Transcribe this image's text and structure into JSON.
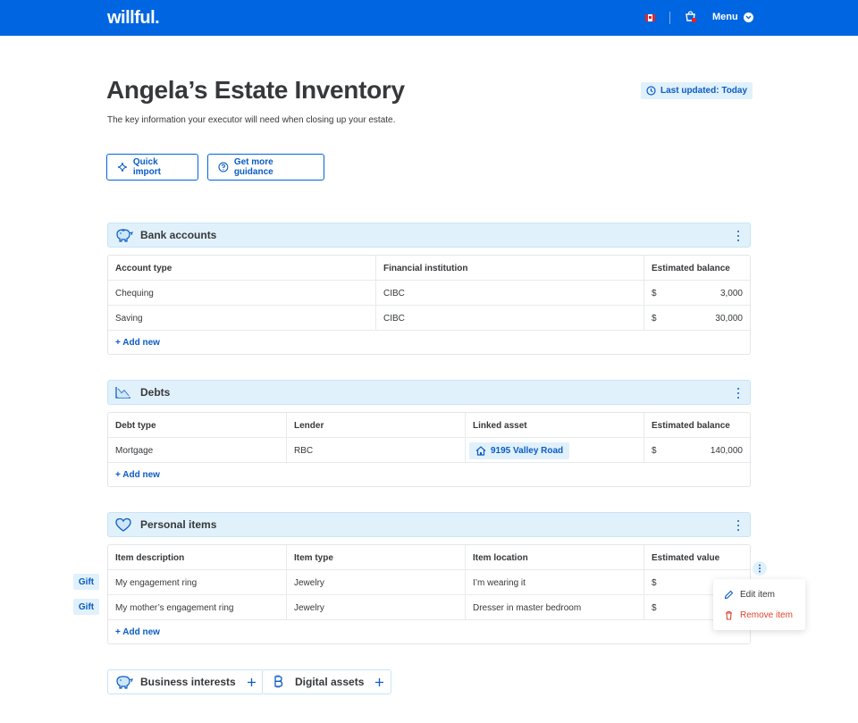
{
  "header": {
    "logo": "willful.",
    "flag_icon": "canada-flag-icon",
    "cart_icon": "cart-icon",
    "menu_label": "Menu"
  },
  "page": {
    "title": "Angela’s Estate Inventory",
    "subtitle": "The key information your executor will need when closing up your estate.",
    "last_updated": "Last updated: Today"
  },
  "actions": {
    "quick_import": "Quick import",
    "guidance": "Get more guidance"
  },
  "bank_accounts": {
    "title": "Bank accounts",
    "headers": [
      "Account type",
      "Financial institution",
      "Estimated balance"
    ],
    "rows": [
      {
        "type": "Chequing",
        "institution": "CIBC",
        "currency": "$",
        "balance": "3,000"
      },
      {
        "type": "Saving",
        "institution": "CIBC",
        "currency": "$",
        "balance": "30,000"
      }
    ],
    "add_label": "+ Add new"
  },
  "debts": {
    "title": "Debts",
    "headers": [
      "Debt type",
      "Lender",
      "Linked asset",
      "Estimated balance"
    ],
    "rows": [
      {
        "type": "Mortgage",
        "lender": "RBC",
        "asset": "9195 Valley Road",
        "currency": "$",
        "balance": "140,000"
      }
    ],
    "add_label": "+ Add new"
  },
  "personal_items": {
    "title": "Personal items",
    "headers": [
      "Item description",
      "Item type",
      "Item location",
      "Estimated value"
    ],
    "rows": [
      {
        "tag": "Gift",
        "description": "My engagement ring",
        "type": "Jewelry",
        "location": "I’m wearing it",
        "currency": "$"
      },
      {
        "tag": "Gift",
        "description": "My mother’s engagement ring",
        "type": "Jewelry",
        "location": "Dresser in master bedroom",
        "currency": "$"
      }
    ],
    "add_label": "+ Add new"
  },
  "context_menu": {
    "edit": "Edit item",
    "remove": "Remove item"
  },
  "more_sections": {
    "business": "Business interests",
    "digital": "Digital assets"
  },
  "colors": {
    "brand_blue": "#0065e0",
    "link_blue": "#0a5cc4",
    "section_bg": "#e1f1fb",
    "danger": "#e0442c"
  }
}
